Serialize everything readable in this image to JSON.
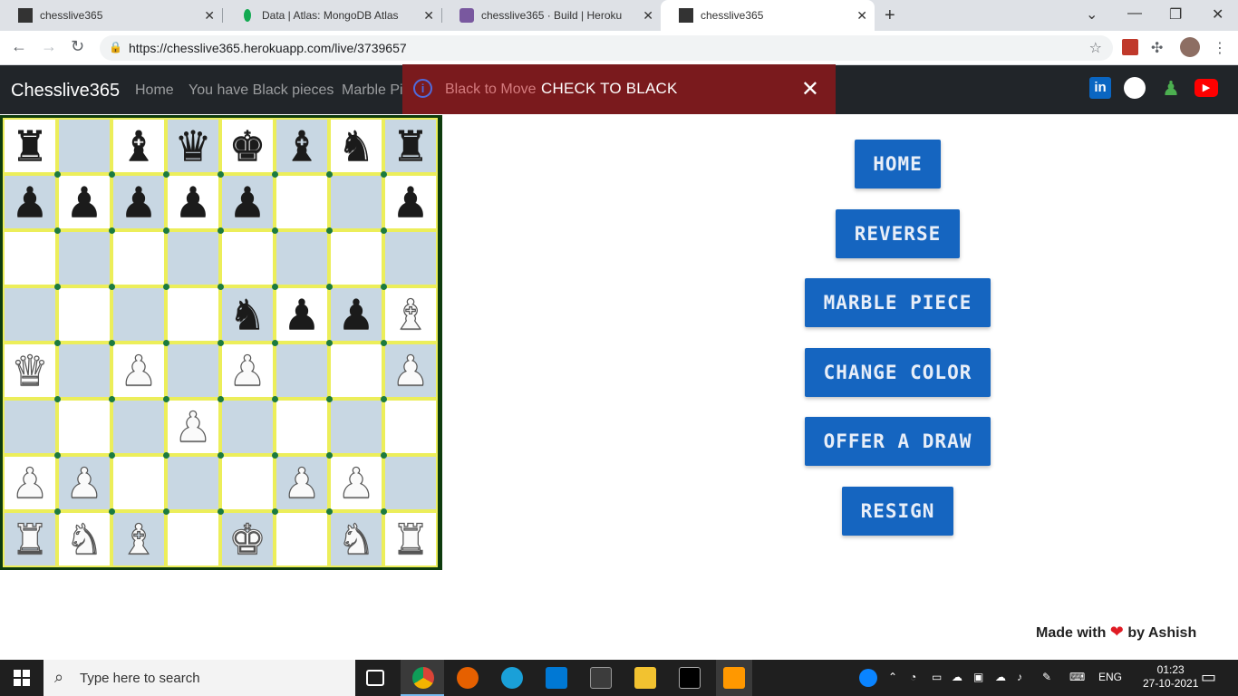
{
  "browser": {
    "tabs": [
      {
        "title": "chesslive365",
        "active": false
      },
      {
        "title": "Data | Atlas: MongoDB Atlas",
        "active": false
      },
      {
        "title": "chesslive365 · Build | Heroku",
        "active": false
      },
      {
        "title": "chesslive365",
        "active": true
      }
    ],
    "url": "https://chesslive365.herokuapp.com/live/3739657"
  },
  "nav": {
    "brand": "Chesslive365",
    "links": [
      "Home",
      "You have Black pieces",
      "Marble Pieces"
    ]
  },
  "alert": {
    "turn": "Black to Move",
    "message": "CHECK TO BLACK"
  },
  "board": {
    "rows": [
      [
        "br",
        "",
        "bb",
        "bq",
        "bk",
        "bb",
        "bn",
        "br"
      ],
      [
        "bp",
        "bp",
        "bp",
        "bp",
        "bp",
        "",
        "",
        "bp"
      ],
      [
        "",
        "",
        "",
        "",
        "",
        "",
        "",
        ""
      ],
      [
        "",
        "",
        "",
        "",
        "bn",
        "bp",
        "bp",
        "wb"
      ],
      [
        "wq",
        "",
        "wp",
        "",
        "wp",
        "",
        "",
        "wp"
      ],
      [
        "",
        "",
        "",
        "wp",
        "",
        "",
        "",
        ""
      ],
      [
        "wp",
        "wp",
        "",
        "",
        "",
        "wp",
        "wp",
        ""
      ],
      [
        "wr",
        "wn",
        "wb",
        "",
        "wk",
        "",
        "wn",
        "wr"
      ]
    ],
    "colors": {
      "light": "#ffffff",
      "dark": "#c8d7e3",
      "border": "#ecee5a",
      "frame": "#0d3b0d"
    }
  },
  "controls": {
    "home": "HOME",
    "reverse": "REVERSE",
    "marble": "MARBLE PIECE",
    "change_color": "CHANGE COLOR",
    "draw": "OFFER A DRAW",
    "resign": "RESIGN",
    "color": "#1565c0"
  },
  "footer": {
    "made_prefix": "Made with",
    "made_suffix": "by Ashish"
  },
  "taskbar": {
    "search_placeholder": "Type here to search",
    "lang": "ENG",
    "time": "01:23",
    "date": "27-10-2021"
  }
}
